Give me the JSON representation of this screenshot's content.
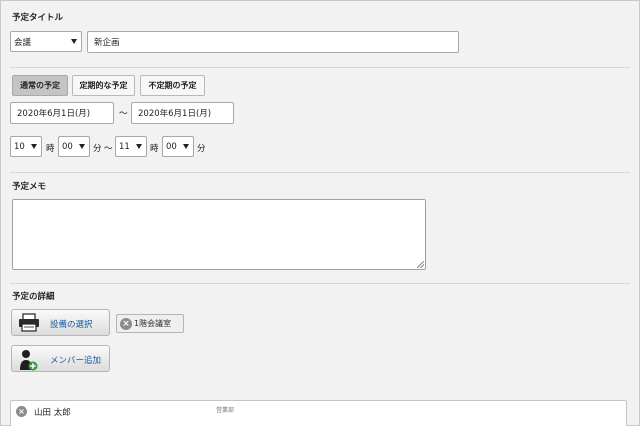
{
  "title_section": {
    "label": "予定タイトル",
    "category_select": "会議",
    "title_value": "新企画"
  },
  "schedule_tabs": [
    {
      "label": "通常の予定",
      "active": true
    },
    {
      "label": "定期的な予定",
      "active": false
    },
    {
      "label": "不定期の予定",
      "active": false
    }
  ],
  "date_range": {
    "start_date": "2020年6月1日(月)",
    "separator": "～",
    "end_date": "2020年6月1日(月)"
  },
  "time_range": {
    "start_hour": "10",
    "hour_unit": "時",
    "start_minute": "00",
    "minute_unit": "分",
    "separator": "～",
    "end_hour": "11",
    "end_minute": "00"
  },
  "memo": {
    "label": "予定メモ",
    "value": ""
  },
  "details": {
    "label": "予定の詳細",
    "facility_button": "設備の選択",
    "facility_chip": "1階会議室",
    "member_button": "メンバー追加"
  },
  "members": [
    {
      "name": "山田 太郎",
      "dept": "営業部"
    }
  ],
  "colors": {
    "background": "#f2f2f2",
    "link_blue": "#1a5aa0",
    "active_tab": "#c4c4c4"
  }
}
